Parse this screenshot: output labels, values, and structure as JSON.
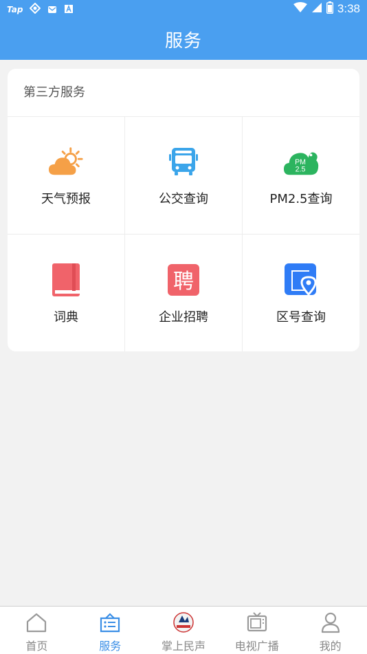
{
  "status_bar": {
    "carrier_icon_text": "Tap",
    "time": "3:38",
    "icons": [
      "tap-icon",
      "sync-icon",
      "mail-icon",
      "a-box-icon",
      "wifi-icon",
      "signal-icon",
      "battery-icon"
    ]
  },
  "header": {
    "title": "服务"
  },
  "section": {
    "title": "第三方服务",
    "items": [
      {
        "label": "天气预报",
        "icon": "weather-icon"
      },
      {
        "label": "公交查询",
        "icon": "bus-icon"
      },
      {
        "label": "PM2.5查询",
        "icon": "pm25-cloud-icon",
        "icon_text_top": "PM",
        "icon_text_bottom": "2.5"
      },
      {
        "label": "词典",
        "icon": "dictionary-book-icon"
      },
      {
        "label": "企业招聘",
        "icon": "recruit-icon",
        "icon_text": "聘"
      },
      {
        "label": "区号查询",
        "icon": "area-code-location-icon"
      }
    ]
  },
  "tabbar": {
    "active": 1,
    "tabs": [
      {
        "label": "首页",
        "icon": "home-icon"
      },
      {
        "label": "服务",
        "icon": "services-icon"
      },
      {
        "label": "掌上民声",
        "icon": "zhangshang-logo-icon"
      },
      {
        "label": "电视广播",
        "icon": "tv-icon"
      },
      {
        "label": "我的",
        "icon": "user-icon"
      }
    ]
  },
  "colors": {
    "primary": "#4a9ff0",
    "tab_active": "#3a8ee6",
    "weather_orange": "#f5a047",
    "bus_blue": "#3ba5ea",
    "pm_green": "#2cb45f",
    "book_red": "#f0636a",
    "recruit_red": "#f0636a",
    "area_blue": "#2f7cf6"
  }
}
